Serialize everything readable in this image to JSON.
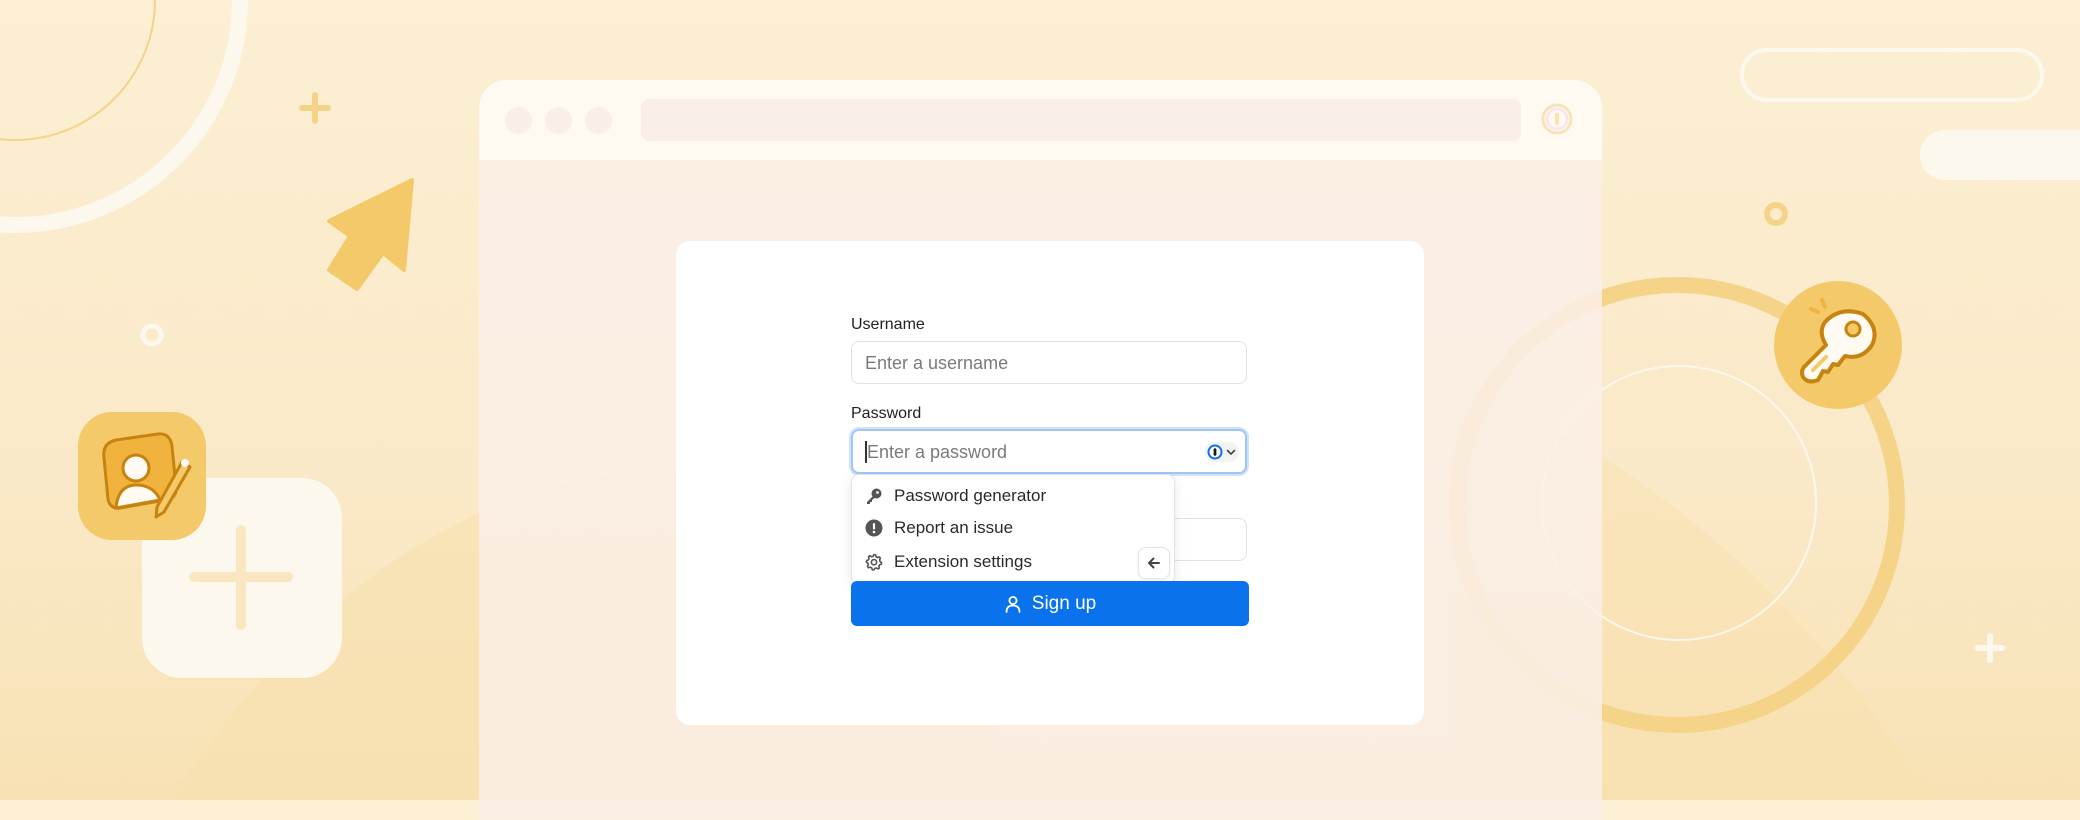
{
  "form": {
    "username_label": "Username",
    "username_placeholder": "Enter a username",
    "username_value": "",
    "password_label": "Password",
    "password_placeholder": "Enter a password",
    "password_value": "",
    "signup_label": "Sign up"
  },
  "autofill_menu": {
    "items": [
      {
        "label": "Password generator",
        "icon": "key-icon"
      },
      {
        "label": "Report an issue",
        "icon": "exclamation-circle-icon"
      },
      {
        "label": "Extension settings",
        "icon": "gear-icon"
      }
    ],
    "back_icon": "arrow-left-icon"
  },
  "colors": {
    "accent": "#0a72ec",
    "focus_ring": "#9ec7f5",
    "background": "#fcefd3",
    "illustration_gold": "#f3c96a",
    "illustration_stroke": "#c78310"
  }
}
